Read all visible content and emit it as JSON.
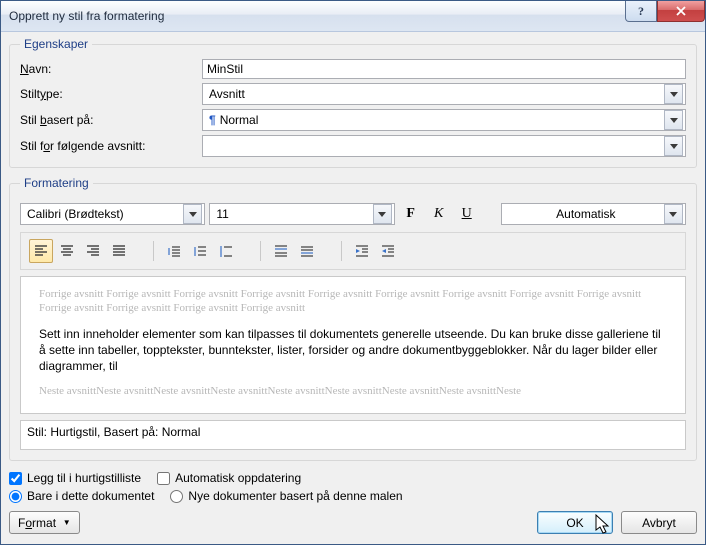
{
  "window": {
    "title": "Opprett ny stil fra formatering"
  },
  "props_legend": "Egenskaper",
  "labels": {
    "name": "avn:",
    "name_ul": "N",
    "styletype": "Stilt",
    "styletype_ul": "y",
    "styletype2": "pe:",
    "basedon": "Stil ",
    "basedon_ul": "b",
    "basedon2": "asert på:",
    "following": "Stil f",
    "following_ul": "o",
    "following2": "r følgende avsnitt:"
  },
  "fields": {
    "name": "MinStil",
    "styletype": "Avsnitt",
    "basedon": "Normal",
    "following": ""
  },
  "formatting_legend": "Formatering",
  "font": {
    "name": "Calibri (Brødtekst)",
    "size": "11",
    "color": "Automatisk"
  },
  "preview": {
    "before": "Forrige avsnitt Forrige avsnitt Forrige avsnitt Forrige avsnitt Forrige avsnitt Forrige avsnitt Forrige avsnitt Forrige avsnitt Forrige avsnitt Forrige avsnitt Forrige avsnitt Forrige avsnitt Forrige avsnitt",
    "body": "Sett inn inneholder elementer som kan tilpasses til dokumentets generelle utseende. Du kan bruke disse galleriene til å sette inn tabeller, topptekster, bunntekster, lister, forsider og andre dokumentbyggeblokker. Når du lager bilder eller diagrammer, til",
    "after": "Neste avsnittNeste avsnittNeste avsnittNeste avsnittNeste avsnittNeste avsnittNeste avsnittNeste avsnittNeste"
  },
  "description": "Stil: Hurtigstil, Basert på: Normal",
  "options": {
    "quicklist": "Legg til i hurtigstilliste",
    "autoupdate": "Automatisk oppdatering",
    "thisdoc": "Bare i dette dokumentet",
    "template": "Nye dokumenter basert på denne malen"
  },
  "buttons": {
    "format": "Format",
    "ok": "OK",
    "cancel": "Avbryt"
  }
}
